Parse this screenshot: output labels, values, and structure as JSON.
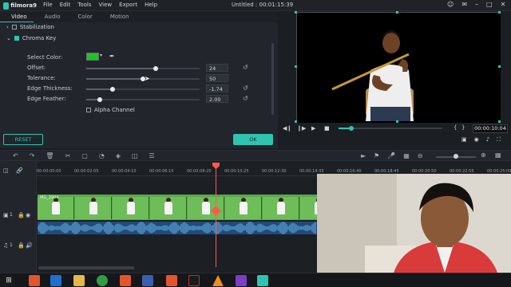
{
  "titlebar": {
    "app_logo_text": "filmora9",
    "menu": [
      "File",
      "Edit",
      "Tools",
      "View",
      "Export",
      "Help"
    ],
    "window_title": "Untitled : 00:01:15:39"
  },
  "tabs": [
    {
      "label": "Video",
      "active": true
    },
    {
      "label": "Audio",
      "active": false
    },
    {
      "label": "Color",
      "active": false
    },
    {
      "label": "Motion",
      "active": false
    }
  ],
  "sections": {
    "stabilization": {
      "label": "Stabilization",
      "checked": false
    },
    "chroma_key": {
      "label": "Chroma Key",
      "checked": true
    }
  },
  "chroma": {
    "select_color_label": "Select Color:",
    "selected_color": "#1ec51e",
    "params": [
      {
        "label": "Offset:",
        "value": "24",
        "level": 0.6
      },
      {
        "label": "Tolerance:",
        "value": "50",
        "level": 0.5
      },
      {
        "label": "Edge Thickness:",
        "value": "-1.74",
        "level": 0.23
      },
      {
        "label": "Edge Feather:",
        "value": "2.00",
        "level": 0.12
      }
    ],
    "alpha_channel_label": "Alpha Channel"
  },
  "buttons": {
    "reset": "RESET",
    "ok": "OK"
  },
  "player": {
    "timecode": "00:00:10:04",
    "progress": 0.12
  },
  "ruler": {
    "ticks": [
      "00:00:00:00",
      "00:00:02:05",
      "00:00:04:10",
      "00:00:06:15",
      "00:00:08:20",
      "00:00:10:25",
      "00:00:12:30",
      "00:00:14:35",
      "00:00:16:40",
      "00:00:18:45",
      "00:00:20:50",
      "00:00:22:55",
      "00:00:25:00"
    ]
  },
  "tracks": {
    "video_label": "1",
    "audio_label": "1",
    "clip_name": "MG_3904"
  },
  "colors": {
    "accent": "#30c3b2",
    "playhead": "#ff5a4a",
    "chroma_green": "#1ec51e"
  }
}
